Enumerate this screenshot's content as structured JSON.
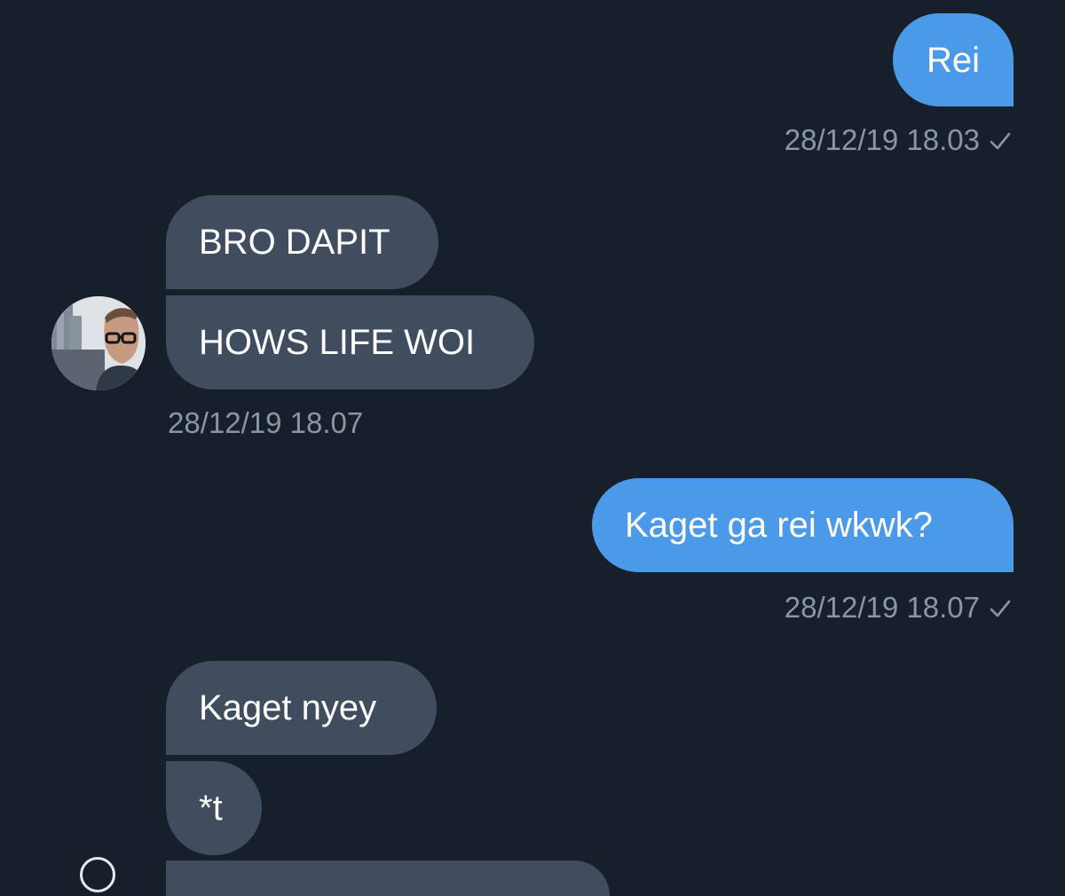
{
  "conversation": {
    "messages": [
      {
        "direction": "sent",
        "text": "Rei"
      },
      {
        "direction": "received",
        "text": "BRO DAPIT"
      },
      {
        "direction": "received",
        "text": "HOWS LIFE WOI"
      },
      {
        "direction": "sent",
        "text": "Kaget ga rei wkwk?"
      },
      {
        "direction": "received",
        "text": "Kaget nyey"
      },
      {
        "direction": "received",
        "text": "*t"
      }
    ],
    "timestamps": [
      "28/12/19 18.03",
      "28/12/19 18.07",
      "28/12/19 18.07"
    ]
  },
  "icons": {
    "read_receipt": "checkmark-icon",
    "contact_avatar": "avatar"
  },
  "colors": {
    "background": "#171f2a",
    "sent_bubble": "#4a9ae9",
    "received_bubble": "#3f4d5f",
    "timestamp": "#8a96a6",
    "text": "#ffffff"
  }
}
